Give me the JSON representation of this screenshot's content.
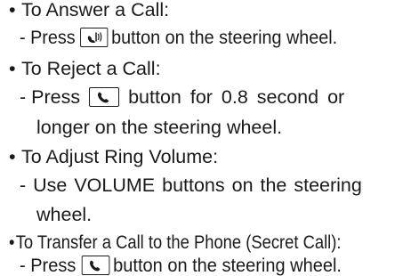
{
  "items": [
    {
      "heading": "To Answer a Call:",
      "lines": [
        {
          "pre": "- Press",
          "icon": "voice-call-icon",
          "post": "button on the steering wheel."
        }
      ]
    },
    {
      "heading": "To Reject a Call:",
      "lines": [
        {
          "pre": "- Press",
          "icon": "phone-handset-icon",
          "post": "button for 0.8 second or"
        },
        {
          "text": "longer on the steering wheel."
        }
      ]
    },
    {
      "heading": "To Adjust Ring Volume:",
      "lines": [
        {
          "text": "- Use VOLUME buttons on the steering"
        },
        {
          "text": "wheel."
        }
      ]
    },
    {
      "heading": "To Transfer a Call to the Phone (Secret Call):",
      "lines": [
        {
          "pre": "- Press",
          "icon": "phone-handset-icon",
          "post": "button on the steering wheel."
        }
      ]
    }
  ]
}
